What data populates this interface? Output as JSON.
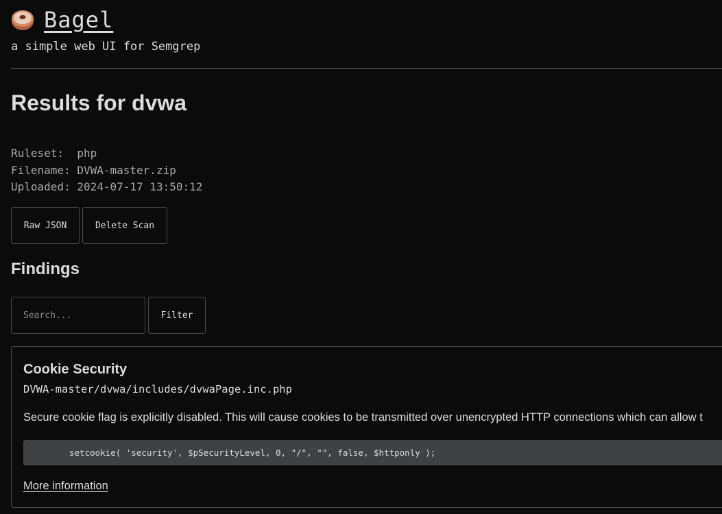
{
  "header": {
    "brand_icon": "bagel-icon",
    "app_name": "Bagel",
    "tagline": "a simple web UI for Semgrep"
  },
  "results": {
    "title": "Results for dvwa",
    "ruleset_label": "Ruleset:",
    "ruleset_value": "php",
    "filename_label": "Filename:",
    "filename_value": "DVWA-master.zip",
    "uploaded_label": "Uploaded:",
    "uploaded_value": "2024-07-17 13:50:12",
    "raw_json_label": "Raw JSON",
    "delete_scan_label": "Delete Scan"
  },
  "findings": {
    "title": "Findings",
    "search_placeholder": "Search...",
    "search_value": "",
    "filter_label": "Filter",
    "items": [
      {
        "title": "Cookie Security",
        "path": "DVWA-master/dvwa/includes/dvwaPage.inc.php",
        "message": "Secure cookie flag is explicitly disabled. This will cause cookies to be transmitted over unencrypted HTTP connections which can allow t",
        "code": "setcookie( 'security', $pSecurityLevel, 0, \"/\", \"\", false, $httponly );",
        "more_info_label": "More information"
      }
    ]
  },
  "colors": {
    "background": "#0b0b0b",
    "text": "#dcdcdc",
    "muted_text": "#a8a8a8",
    "border": "#4a4a4a",
    "code_background": "#3f4245"
  }
}
